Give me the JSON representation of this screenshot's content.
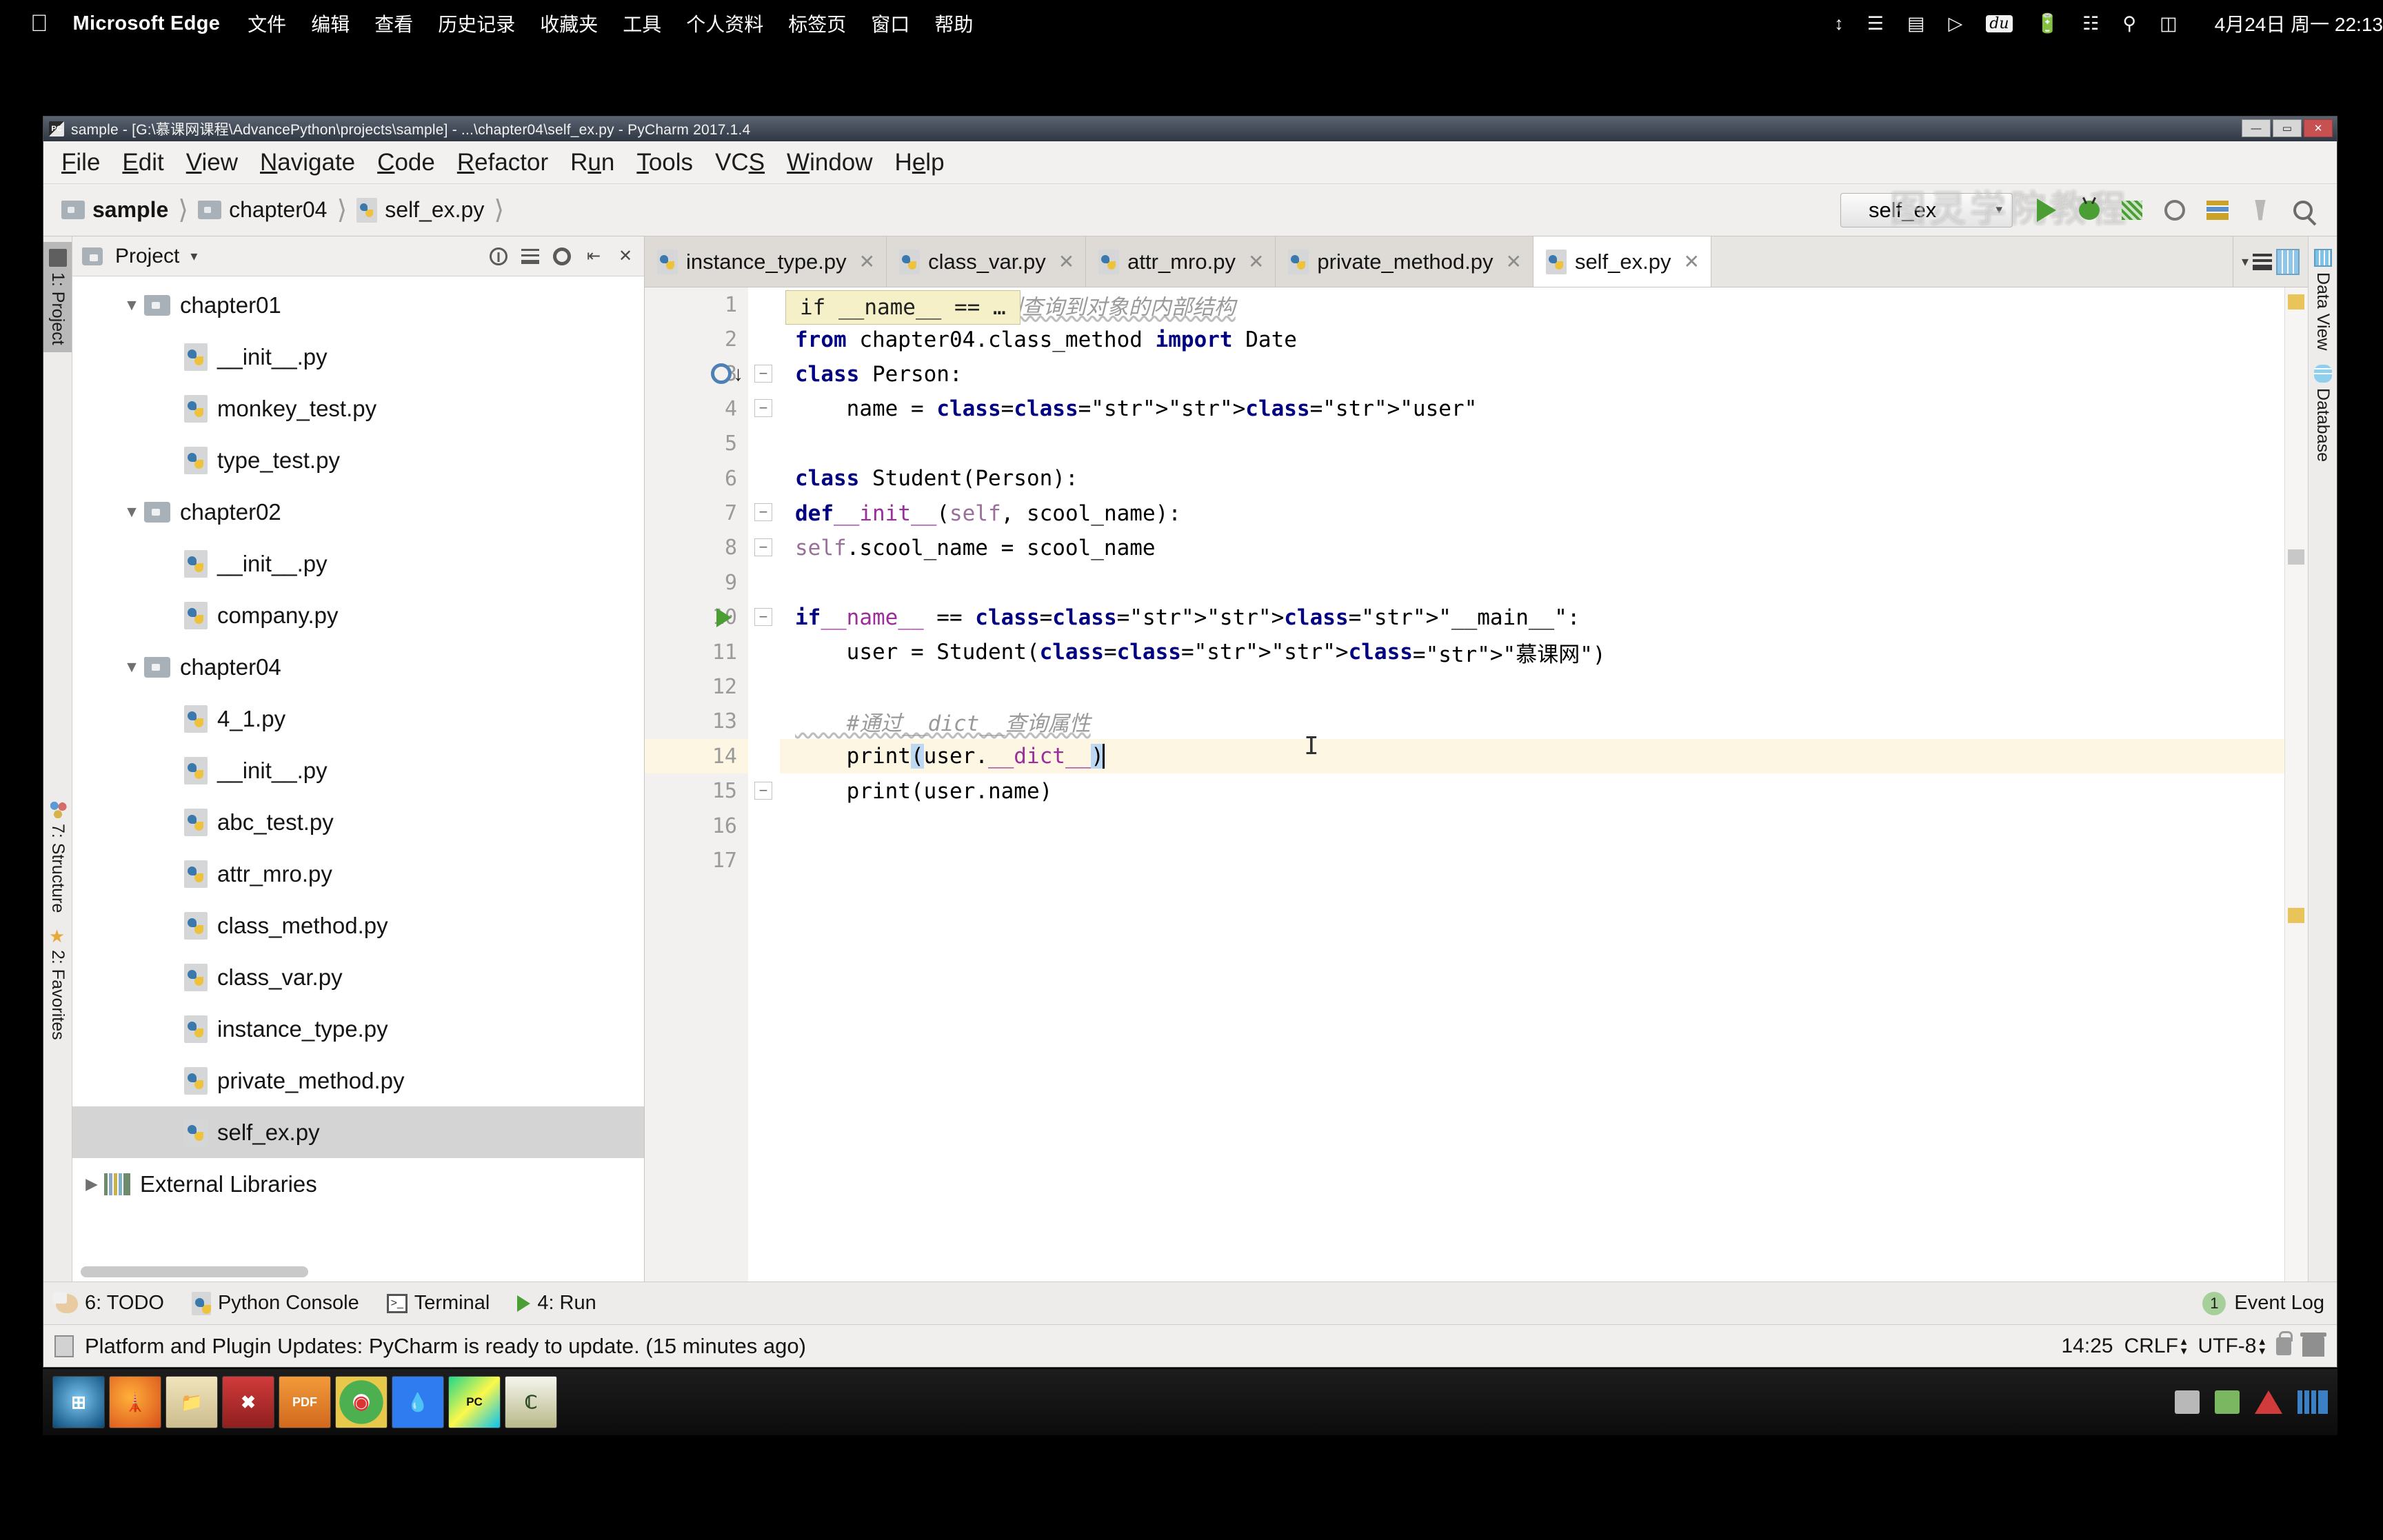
{
  "mac_menubar": {
    "apple_icon": "apple-logo",
    "app_name": "Microsoft Edge",
    "menus": [
      "文件",
      "编辑",
      "查看",
      "历史记录",
      "收藏夹",
      "工具",
      "个人资料",
      "标签页",
      "窗口",
      "帮助"
    ],
    "tray_icons": [
      "updown-arrows-icon",
      "bookmark-icon",
      "sd-card-icon",
      "play-circle-icon",
      "baidu-du-icon",
      "battery-charging-icon",
      "wifi-off-icon",
      "search-icon",
      "control-center-icon"
    ],
    "clock": "4月24日 周一  22:13"
  },
  "window": {
    "title": "sample - [G:\\慕课网课程\\AdvancePython\\projects\\sample] - ...\\chapter04\\self_ex.py - PyCharm 2017.1.4",
    "app_icon": "pycharm-icon",
    "minimize_label": "—",
    "maximize_label": "▭",
    "close_label": "✕"
  },
  "menubar": [
    {
      "pre": "",
      "mn": "F",
      "post": "ile"
    },
    {
      "pre": "",
      "mn": "E",
      "post": "dit"
    },
    {
      "pre": "",
      "mn": "V",
      "post": "iew"
    },
    {
      "pre": "",
      "mn": "N",
      "post": "avigate"
    },
    {
      "pre": "",
      "mn": "C",
      "post": "ode"
    },
    {
      "pre": "",
      "mn": "R",
      "post": "efactor"
    },
    {
      "pre": "R",
      "mn": "u",
      "post": "n"
    },
    {
      "pre": "",
      "mn": "T",
      "post": "ools"
    },
    {
      "pre": "VC",
      "mn": "S",
      "post": ""
    },
    {
      "pre": "",
      "mn": "W",
      "post": "indow"
    },
    {
      "pre": "H",
      "mn": "e",
      "post": "lp"
    }
  ],
  "breadcrumb": [
    {
      "label": "sample",
      "icon": "folder-icon",
      "bold": true
    },
    {
      "label": "chapter04",
      "icon": "folder-icon",
      "bold": false
    },
    {
      "label": "self_ex.py",
      "icon": "python-file-icon",
      "bold": false
    }
  ],
  "watermark": "图灵学院教程",
  "toolbar": {
    "run_config": "self_ex",
    "run_config_icon": "python-icon",
    "caret": "▾",
    "buttons": [
      "run-icon",
      "debug-icon",
      "coverage-icon",
      "profile-icon",
      "deploy-icon",
      "build-icon",
      "search-everywhere-icon"
    ]
  },
  "left_rail": [
    {
      "label": "1: Project",
      "mn": "1",
      "icon": "project-icon",
      "active": true
    },
    {
      "label": "7: Structure",
      "mn": "7",
      "icon": "structure-icon",
      "active": false
    },
    {
      "label": "2: Favorites",
      "mn": "2",
      "icon": "star-icon",
      "active": false
    }
  ],
  "right_rail": [
    {
      "label": "Data View",
      "icon": "data-view-icon"
    },
    {
      "label": "Database",
      "icon": "database-icon"
    }
  ],
  "project_panel": {
    "title": "Project",
    "dropdown_caret": "▾",
    "header_icons": [
      "locate-icon",
      "collapse-all-icon",
      "settings-icon",
      "hide-icon",
      "close-icon"
    ],
    "tree": [
      {
        "label": "chapter01",
        "type": "folder",
        "indent": 1,
        "arrow": "▼",
        "selected": false
      },
      {
        "label": "__init__.py",
        "type": "py",
        "indent": 2,
        "arrow": "",
        "selected": false
      },
      {
        "label": "monkey_test.py",
        "type": "py",
        "indent": 2,
        "arrow": "",
        "selected": false
      },
      {
        "label": "type_test.py",
        "type": "py",
        "indent": 2,
        "arrow": "",
        "selected": false
      },
      {
        "label": "chapter02",
        "type": "folder",
        "indent": 1,
        "arrow": "▼",
        "selected": false
      },
      {
        "label": "__init__.py",
        "type": "py",
        "indent": 2,
        "arrow": "",
        "selected": false
      },
      {
        "label": "company.py",
        "type": "py",
        "indent": 2,
        "arrow": "",
        "selected": false
      },
      {
        "label": "chapter04",
        "type": "folder",
        "indent": 1,
        "arrow": "▼",
        "selected": false
      },
      {
        "label": "4_1.py",
        "type": "py",
        "indent": 2,
        "arrow": "",
        "selected": false
      },
      {
        "label": "__init__.py",
        "type": "py",
        "indent": 2,
        "arrow": "",
        "selected": false
      },
      {
        "label": "abc_test.py",
        "type": "py",
        "indent": 2,
        "arrow": "",
        "selected": false
      },
      {
        "label": "attr_mro.py",
        "type": "py",
        "indent": 2,
        "arrow": "",
        "selected": false
      },
      {
        "label": "class_method.py",
        "type": "py",
        "indent": 2,
        "arrow": "",
        "selected": false
      },
      {
        "label": "class_var.py",
        "type": "py",
        "indent": 2,
        "arrow": "",
        "selected": false
      },
      {
        "label": "instance_type.py",
        "type": "py",
        "indent": 2,
        "arrow": "",
        "selected": false
      },
      {
        "label": "private_method.py",
        "type": "py",
        "indent": 2,
        "arrow": "",
        "selected": false
      },
      {
        "label": "self_ex.py",
        "type": "py",
        "indent": 2,
        "arrow": "",
        "selected": true
      },
      {
        "label": "External Libraries",
        "type": "lib",
        "indent": 0,
        "arrow": "▶",
        "selected": false
      }
    ]
  },
  "editor_tabs": [
    {
      "label": "instance_type.py",
      "active": false,
      "close": "✕"
    },
    {
      "label": "class_var.py",
      "active": false,
      "close": "✕"
    },
    {
      "label": "attr_mro.py",
      "active": false,
      "close": "✕"
    },
    {
      "label": "private_method.py",
      "active": false,
      "close": "✕"
    },
    {
      "label": "self_ex.py",
      "active": true,
      "close": "✕"
    }
  ],
  "editor": {
    "sticky_hint": "if __name__ == …",
    "line_numbers": [
      "1",
      "2",
      "3",
      "4",
      "5",
      "6",
      "7",
      "8",
      "9",
      "10",
      "11",
      "12",
      "13",
      "14",
      "15",
      "16",
      "17"
    ],
    "highlighted_line": 14,
    "caret_line": 14,
    "code_lines": [
      "#自省是通过一定的机制查询到对象的内部结构",
      "from chapter04.class_method import Date",
      "class Person:",
      "    name = \"user\"",
      "",
      "class Student(Person):",
      "    def __init__(self, scool_name):",
      "        self.scool_name = scool_name",
      "",
      "if __name__ == \"__main__\":",
      "    user = Student(\"慕课网\")",
      "",
      "    #通过__dict__查询属性",
      "    print(user.__dict__)",
      "    print(user.name)",
      "",
      ""
    ]
  },
  "bottom_toolwindows": [
    {
      "label": "6: TODO",
      "mn": "6",
      "icon": "todo-icon"
    },
    {
      "label": "Python Console",
      "mn": "",
      "icon": "python-icon"
    },
    {
      "label": "Terminal",
      "mn": "",
      "icon": "terminal-icon"
    },
    {
      "label": "4: Run",
      "mn": "4",
      "icon": "run-icon"
    }
  ],
  "event_log": {
    "count": "1",
    "label": "Event Log"
  },
  "statusbar": {
    "message": "Platform and Plugin Updates: PyCharm is ready to update. (15 minutes ago)",
    "caret_position": "14:25",
    "line_separator": "CRLF",
    "encoding": "UTF-8",
    "lock_icon": "unlocked-icon",
    "inspector_icon": "inspector-icon"
  },
  "taskbar": {
    "icons": [
      "windows-start-icon",
      "firefox-icon",
      "explorer-icon",
      "xmind-icon",
      "pdf-icon",
      "chrome-icon",
      "drop-icon",
      "pycharm-icon",
      "cmder-icon"
    ],
    "tray": [
      "monitor-icon",
      "green-chip-icon",
      "red-triangle-icon",
      "blue-bars-icon"
    ]
  }
}
